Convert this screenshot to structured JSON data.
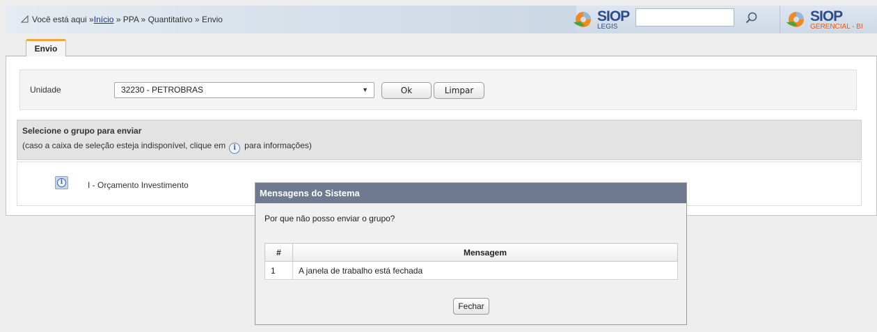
{
  "breadcrumb": {
    "prefix": "Você está aqui »",
    "home_link": "Início",
    "rest": " » PPA » Quantitativo » Envio"
  },
  "logos": {
    "legis": {
      "title": "SIOP",
      "subtitle": "LEGIS"
    },
    "gerencial": {
      "title": "SIOP",
      "subtitle": "GERENCIAL - BI"
    }
  },
  "search": {
    "value": "",
    "icon": "search-icon"
  },
  "tabs": [
    {
      "label": "Envio",
      "active": true
    }
  ],
  "filter": {
    "unidade_label": "Unidade",
    "unidade_selected": "32230 - PETROBRAS",
    "ok_label": "Ok",
    "limpar_label": "Limpar"
  },
  "group": {
    "title": "Selecione o grupo para enviar",
    "note_before": "(caso a caixa de seleção esteja indisponível, clique em",
    "note_after": "para informações)",
    "items": [
      {
        "label": "I - Orçamento Investimento",
        "icon": "info-icon"
      }
    ]
  },
  "modal": {
    "title": "Mensagens do Sistema",
    "question": "Por que não posso enviar o grupo?",
    "columns": [
      "#",
      "Mensagem"
    ],
    "rows": [
      {
        "num": "1",
        "message": "A janela de trabalho está fechada"
      }
    ],
    "close_label": "Fechar"
  },
  "colors": {
    "tab_accent": "#f0a43a",
    "modal_header": "#6f7a91",
    "link": "#1b2fa8",
    "logo_orange": "#f08a1e",
    "logo_blue": "#2d4d8a"
  }
}
